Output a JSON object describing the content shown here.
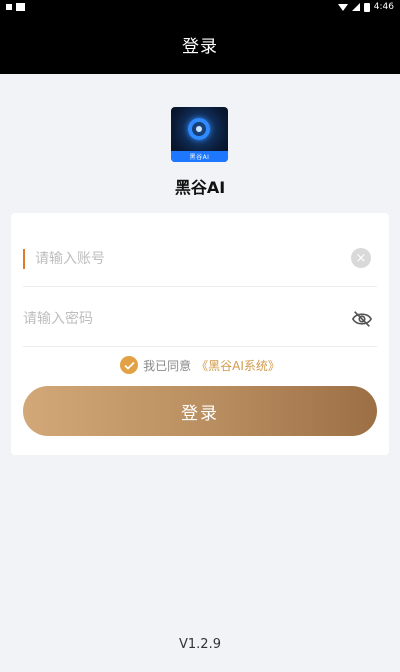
{
  "status_bar": {
    "time": "4:46",
    "icons": [
      "notification-icon",
      "image-icon",
      "wifi-icon",
      "signal-icon",
      "battery-icon"
    ]
  },
  "header": {
    "title": "登录"
  },
  "app": {
    "name": "黑谷AI",
    "logo_band_text": "黑谷AI"
  },
  "form": {
    "account_placeholder": "请输入账号",
    "account_value": "",
    "password_placeholder": "请输入密码",
    "password_value": "",
    "agree_prefix": "我已同意",
    "agree_link": "《黑谷AI系统》",
    "agreed": true,
    "submit_label": "登录"
  },
  "footer": {
    "version": "V1.2.9"
  },
  "colors": {
    "header_bg": "#000000",
    "page_bg": "#f2f3f7",
    "accent": "#e2a144",
    "button_start": "#d2a878",
    "button_end": "#9c6f45"
  }
}
